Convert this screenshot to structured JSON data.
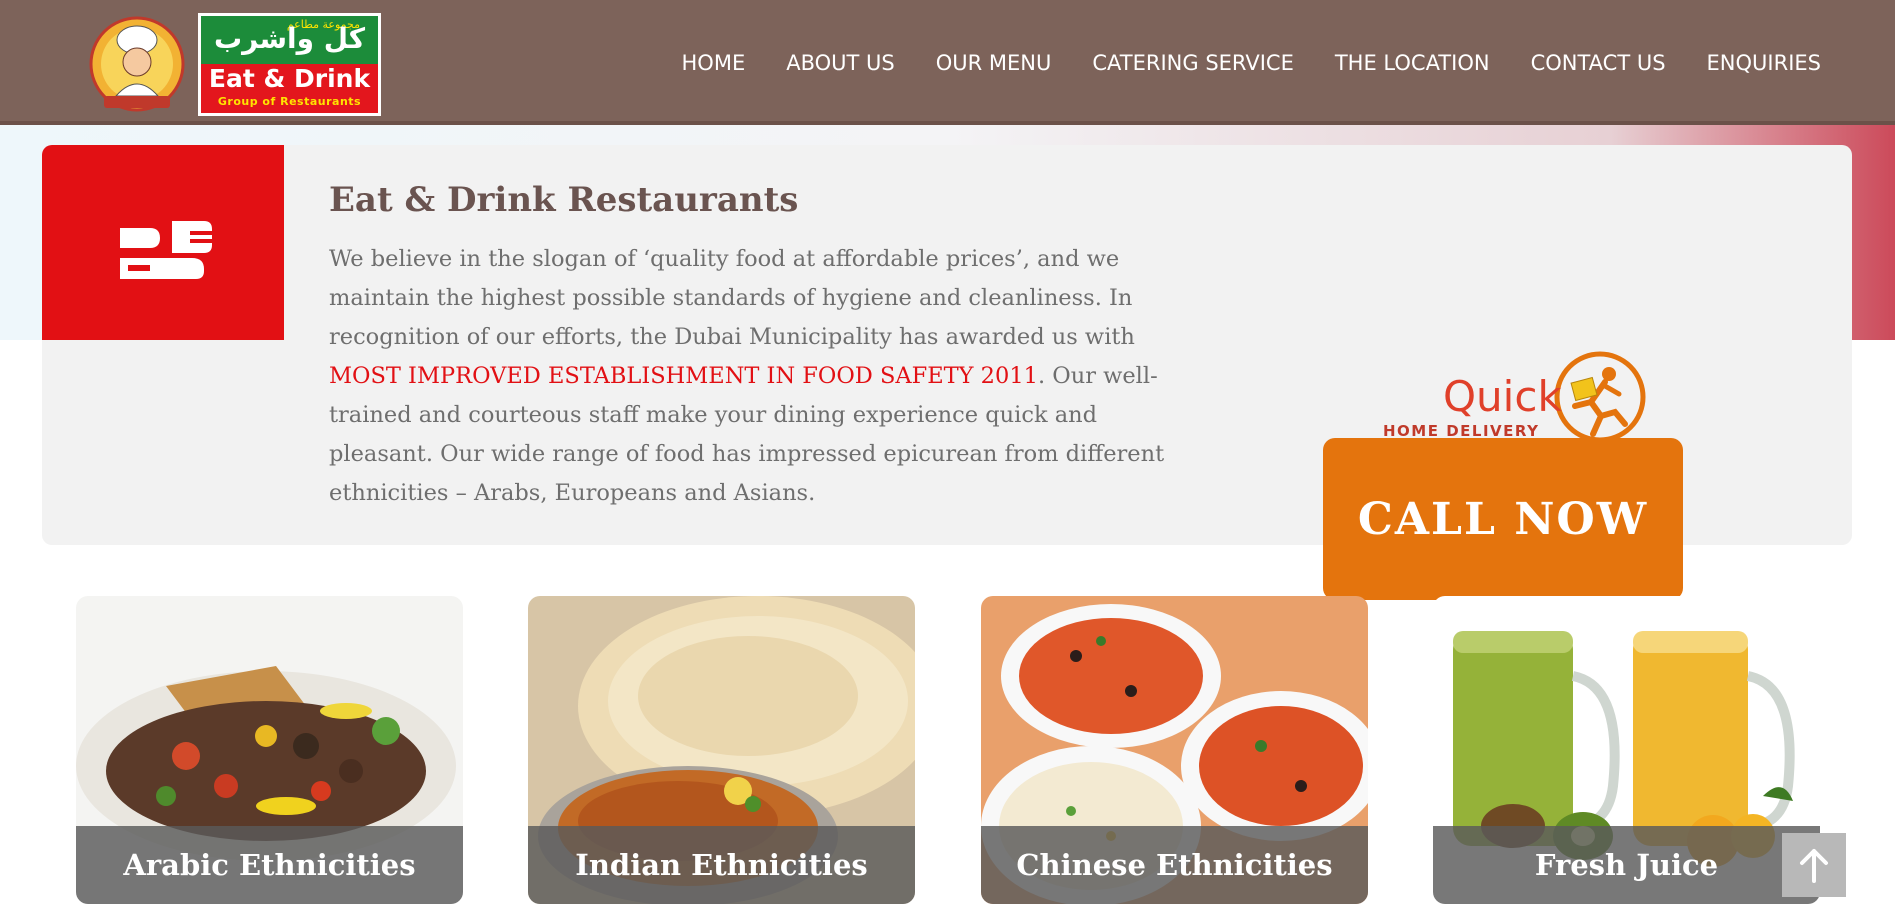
{
  "header": {
    "logo_arabic_top": "مجموعة مطاعم",
    "logo_arabic": "كل واشرب",
    "logo_brand": "Eat & Drink",
    "logo_sub": "Group of Restaurants",
    "nav": [
      {
        "label": "HOME"
      },
      {
        "label": "ABOUT US"
      },
      {
        "label": "OUR MENU"
      },
      {
        "label": "CATERING SERVICE"
      },
      {
        "label": "THE LOCATION"
      },
      {
        "label": "CONTACT US"
      },
      {
        "label": "ENQUIRIES"
      }
    ]
  },
  "intro": {
    "icon": "utensils-icon",
    "title": "Eat & Drink Restaurants",
    "para_before": "We believe in the slogan of ‘quality food at affordable prices’, and we maintain the highest possible standards of hygiene and cleanliness. In recognition of our efforts, the Dubai Municipality has awarded us with ",
    "para_highlight": "MOST IMPROVED ESTABLISHMENT IN FOOD SAFETY 2011",
    "para_after": ". Our well-trained and courteous staff make your dining experience quick and pleasant. Our wide range of food has impressed epicurean from different ethnicities – Arabs, Europeans and Asians."
  },
  "delivery": {
    "quick": "Quick",
    "home_delivery": "HOME DELIVERY",
    "call_label": "CALL NOW"
  },
  "cards": [
    {
      "caption": "Arabic Ethnicities"
    },
    {
      "caption": "Indian Ethnicities"
    },
    {
      "caption": "Chinese Ethnicities"
    },
    {
      "caption": "Fresh Juice"
    }
  ],
  "colors": {
    "header_bg": "#7d635a",
    "accent_red": "#e21014",
    "call_orange": "#e4740d",
    "title_brown": "#6a5450"
  },
  "scroll_top_icon": "arrow-up-icon"
}
